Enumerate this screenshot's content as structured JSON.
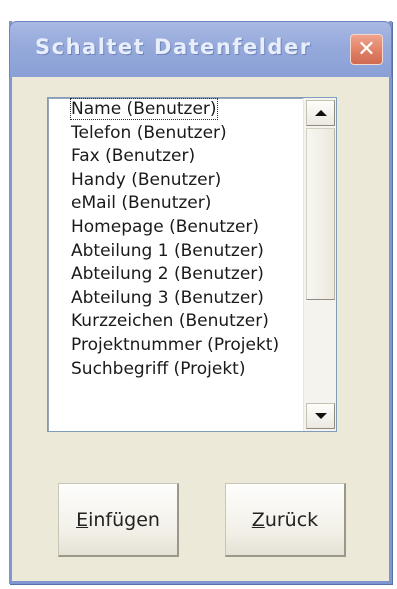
{
  "window": {
    "title": "Schaltet Datenfelder",
    "close_glyph": "✕"
  },
  "list": {
    "items": [
      "Name (Benutzer)",
      "Telefon (Benutzer)",
      "Fax (Benutzer)",
      "Handy (Benutzer)",
      "eMail (Benutzer)",
      "Homepage (Benutzer)",
      "Abteilung 1 (Benutzer)",
      "Abteilung 2 (Benutzer)",
      "Abteilung 3 (Benutzer)",
      "Kurzzeichen (Benutzer)",
      "Projektnummer (Projekt)",
      "Suchbegriff (Projekt)"
    ],
    "focused_index": 0
  },
  "buttons": {
    "insert_label": "Einfügen",
    "back_label": "Zurück"
  },
  "icons": {
    "close": "close-icon",
    "scroll_up": "arrow-up-icon",
    "scroll_down": "arrow-down-icon"
  }
}
